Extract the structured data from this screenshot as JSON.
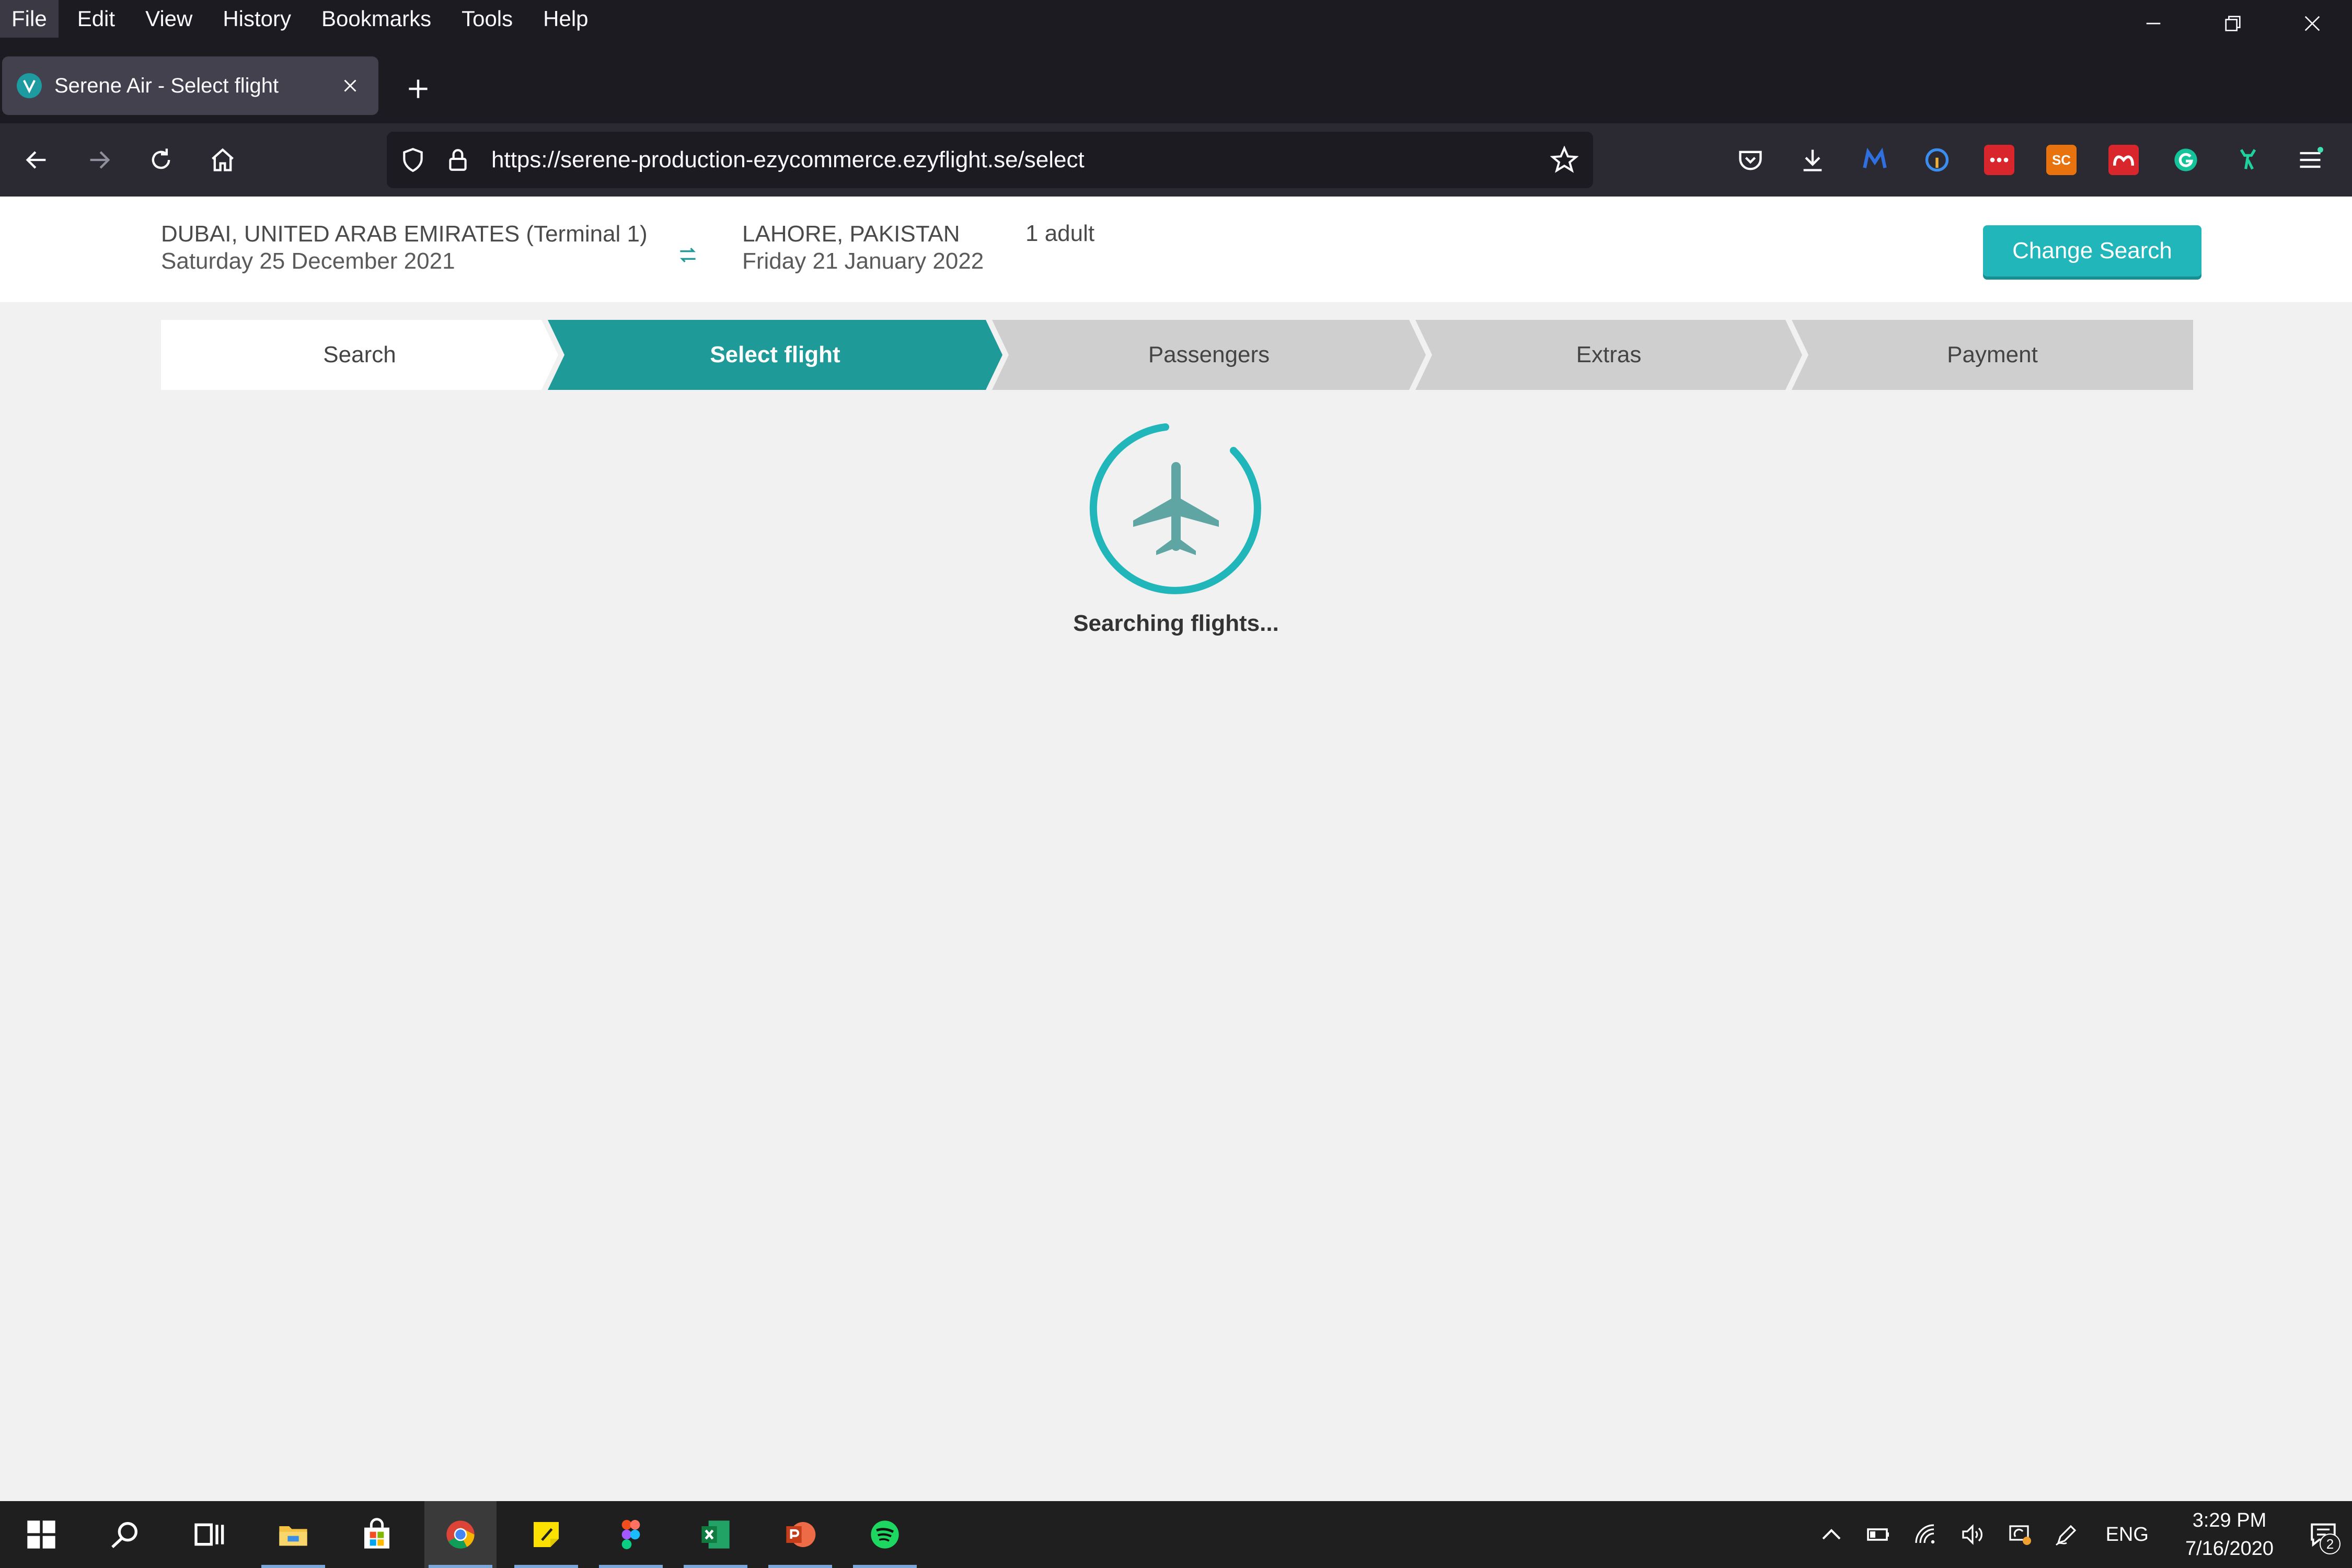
{
  "menubar": {
    "items": [
      "File",
      "Edit",
      "View",
      "History",
      "Bookmarks",
      "Tools",
      "Help"
    ]
  },
  "tab": {
    "title": "Serene Air - Select flight"
  },
  "urlbar": {
    "url": "https://serene-production-ezycommerce.ezyflight.se/select"
  },
  "extensions": {
    "sc_label": "SC"
  },
  "summary": {
    "origin": "DUBAI, UNITED ARAB EMIRATES (Terminal 1)",
    "origin_date": "Saturday 25 December 2021",
    "destination": "LAHORE, PAKISTAN",
    "destination_date": "Friday 21 January 2022",
    "passengers": "1 adult",
    "change_label": "Change Search"
  },
  "steps": {
    "search": "Search",
    "select": "Select flight",
    "passengers": "Passengers",
    "extras": "Extras",
    "payment": "Payment",
    "active": "Select flight"
  },
  "loader": {
    "text": "Searching flights..."
  },
  "taskbar": {
    "language": "ENG",
    "time": "3:29 PM",
    "date": "7/16/2020",
    "notifications": "2"
  },
  "colors": {
    "teal": "#1e9a98",
    "button": "#21b6b9",
    "chrome_bg": "#1c1b22"
  }
}
